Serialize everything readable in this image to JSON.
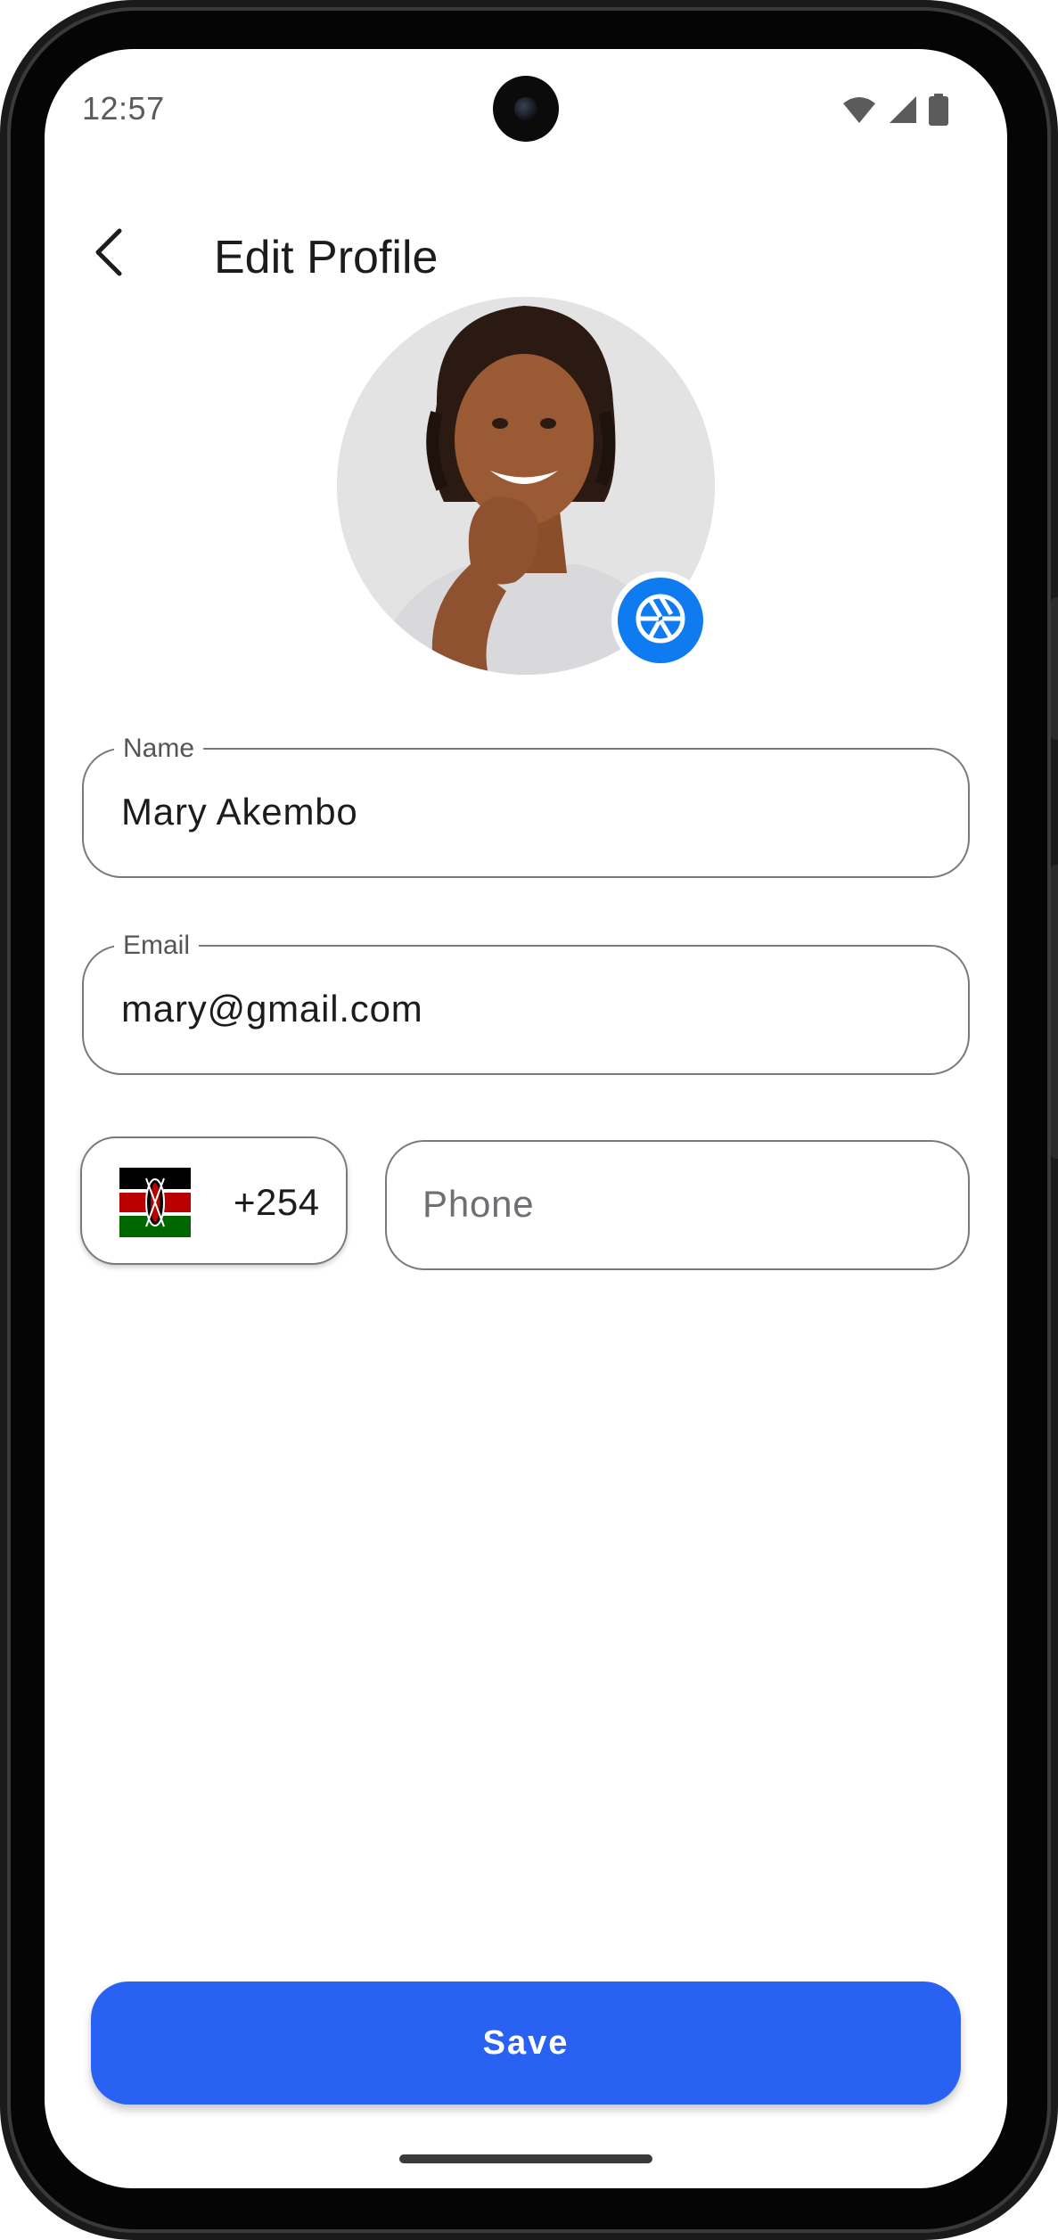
{
  "status_bar": {
    "time": "12:57",
    "icons": [
      "wifi-icon",
      "signal-icon",
      "battery-icon"
    ]
  },
  "app_bar": {
    "back_icon": "chevron-left-icon",
    "title": "Edit Profile"
  },
  "avatar": {
    "edit_icon": "camera-shutter-icon",
    "accent_color": "#0f7bf0"
  },
  "form": {
    "name": {
      "label": "Name",
      "value": "Mary Akembo"
    },
    "email": {
      "label": "Email",
      "value": "mary@gmail.com"
    },
    "country": {
      "flag": "kenya-flag-icon",
      "dial_code": "+254"
    },
    "phone": {
      "placeholder": "Phone",
      "value": ""
    }
  },
  "actions": {
    "save_label": "Save",
    "save_color": "#2962f2"
  }
}
